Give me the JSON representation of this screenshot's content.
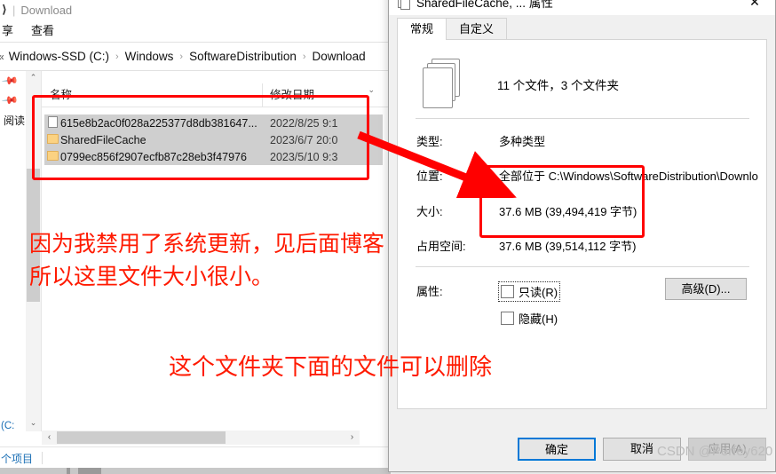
{
  "explorer": {
    "title_icon": "folder-icon",
    "title": "Download",
    "ribbon_tabs": [
      {
        "label": "享"
      },
      {
        "label": "查看"
      }
    ],
    "address": {
      "overflow_icon": "double-chevron-left-icon",
      "crumbs": [
        "Windows-SSD (C:)",
        "Windows",
        "SoftwareDistribution",
        "Download"
      ],
      "separator": "›"
    },
    "nav_pane": {
      "items": [
        {
          "icon": "pin-icon",
          "label": ""
        },
        {
          "icon": "pin-icon",
          "label": ""
        },
        {
          "icon": "",
          "label": "阅读"
        }
      ],
      "bottom_item": "(C:",
      "scroll_up": "⌃",
      "scroll_down": "⌄"
    },
    "columns": [
      {
        "key": "name",
        "label": "名称"
      },
      {
        "key": "date",
        "label": "修改日期"
      }
    ],
    "sort_indicator": "⌄",
    "rows": [
      {
        "icon": "document-icon",
        "name": "615e8b2ac0f028a225377d8db381647...",
        "date": "2022/8/25 9:1",
        "selected": true
      },
      {
        "icon": "folder-icon",
        "name": "SharedFileCache",
        "date": "2023/6/7 20:0",
        "selected": true
      },
      {
        "icon": "folder-icon",
        "name": "0799ec856f2907ecfb87c28eb3f47976",
        "date": "2023/5/10 9:3",
        "selected": true
      }
    ],
    "hscroll": {
      "left_arrow": "‹",
      "right_arrow": "›"
    },
    "status": "个项目"
  },
  "dialog": {
    "icon": "multi-document-icon",
    "title": "SharedFileCache, ... 属性",
    "close_icon": "close-icon",
    "tabs": [
      {
        "label": "常规",
        "active": true
      },
      {
        "label": "自定义",
        "active": false
      }
    ],
    "summary": "11 个文件，3 个文件夹",
    "fields": [
      {
        "label": "类型:",
        "value": "多种类型"
      },
      {
        "label": "位置:",
        "value": "全部位于 C:\\Windows\\SoftwareDistribution\\Downlo"
      },
      {
        "label": "大小:",
        "value": "37.6 MB (39,494,419 字节)"
      },
      {
        "label": "占用空间:",
        "value": "37.6 MB (39,514,112 字节)"
      }
    ],
    "attributes": {
      "label": "属性:",
      "readonly": {
        "label": "只读(R)",
        "checked": false,
        "focused": true
      },
      "hidden": {
        "label": "隐藏(H)",
        "checked": false,
        "focused": false
      }
    },
    "advanced_button": "高级(D)...",
    "buttons": {
      "ok": "确定",
      "cancel": "取消",
      "apply": "应用(A)"
    }
  },
  "annotations": {
    "line1": "因为我禁用了系统更新，见后面博客",
    "line2": "所以这里文件大小很小。",
    "line3": "这个文件夹下面的文件可以删除",
    "highlight_color": "#ff0000",
    "text_color": "#ff1a00"
  },
  "watermark": "CSDN @Perfey620"
}
